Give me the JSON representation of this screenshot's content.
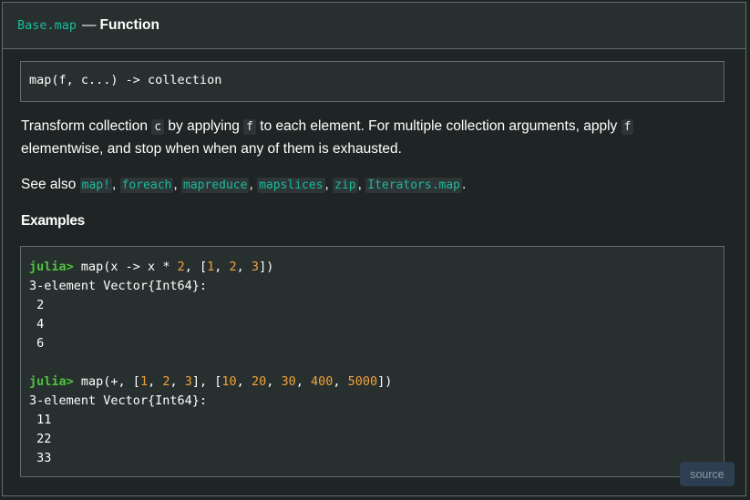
{
  "header": {
    "binding": "Base.map",
    "dash": "—",
    "category": "Function"
  },
  "signature": "map(f, c...) -> collection",
  "description": {
    "text1": "Transform collection ",
    "code_c": "c",
    "text2": " by applying ",
    "code_f1": "f",
    "text3": " to each element. For multiple collection arguments, apply ",
    "code_f2": "f",
    "text4": " elementwise, and stop when when any of them is exhausted."
  },
  "see_also": {
    "label": "See also ",
    "links": [
      "map!",
      "foreach",
      "mapreduce",
      "mapslices",
      "zip",
      "Iterators.map"
    ],
    "sep": ", ",
    "end": "."
  },
  "examples_heading": "Examples",
  "code": {
    "prompt": "julia>",
    "ex1_pre": " map(x -> x * ",
    "ex1_n1": "2",
    "ex1_mid1": ", [",
    "ex1_n2": "1",
    "ex1_c1": ", ",
    "ex1_n3": "2",
    "ex1_c2": ", ",
    "ex1_n4": "3",
    "ex1_end": "])",
    "out1_header": "3-element Vector{Int64}:",
    "out1_values": [
      " 2",
      " 4",
      " 6"
    ],
    "ex2_pre": " map(+, [",
    "ex2_a": [
      "1",
      "2",
      "3"
    ],
    "ex2_mid": "], [",
    "ex2_b": [
      "10",
      "20",
      "30",
      "400",
      "5000"
    ],
    "ex2_end": "])",
    "out2_header": "3-element Vector{Int64}:",
    "out2_values": [
      " 11",
      " 22",
      " 33"
    ]
  },
  "source_button": "source",
  "colors": {
    "accent": "#1abc9c",
    "prompt": "#4ec43f",
    "number": "#f0a33a",
    "background": "#1f2424",
    "panel": "#282f2f",
    "border": "#5e6d6f"
  }
}
